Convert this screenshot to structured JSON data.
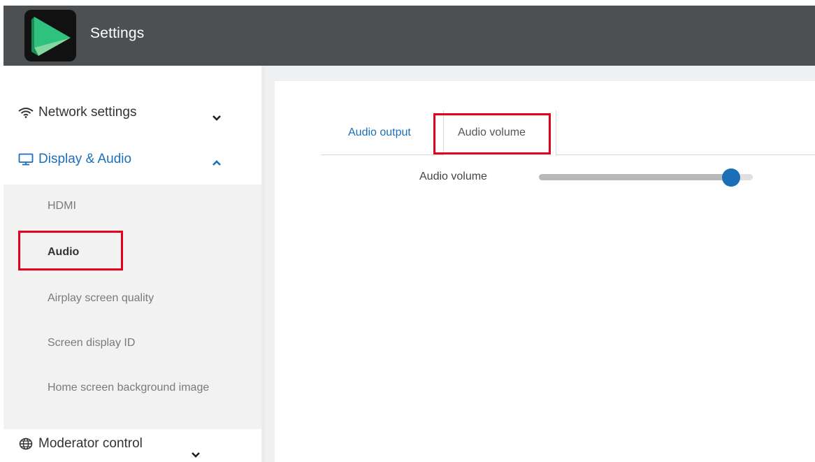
{
  "header": {
    "title": "Settings",
    "logo_icon": "play-logo-icon",
    "background_color": "#4d5052"
  },
  "sidebar": {
    "groups": [
      {
        "label": "Network settings",
        "icon": "wifi-icon",
        "expanded": false
      },
      {
        "label": "Display & Audio",
        "icon": "monitor-icon",
        "expanded": true
      },
      {
        "label": "Moderator control",
        "icon": "globe-icon",
        "expanded": false
      }
    ],
    "sub_items": [
      {
        "label": "HDMI",
        "selected": false
      },
      {
        "label": "Audio",
        "selected": true
      },
      {
        "label": "Airplay screen quality",
        "selected": false
      },
      {
        "label": "Screen display ID",
        "selected": false
      },
      {
        "label": "Home screen background image",
        "selected": false
      }
    ]
  },
  "main": {
    "tabs": [
      {
        "label": "Audio output",
        "active": false
      },
      {
        "label": "Audio volume",
        "active": true
      }
    ],
    "volume": {
      "label": "Audio volume",
      "value_fraction": 0.9
    }
  },
  "colors": {
    "accent": "#1a6fb8",
    "highlight_box": "#e3001b"
  }
}
